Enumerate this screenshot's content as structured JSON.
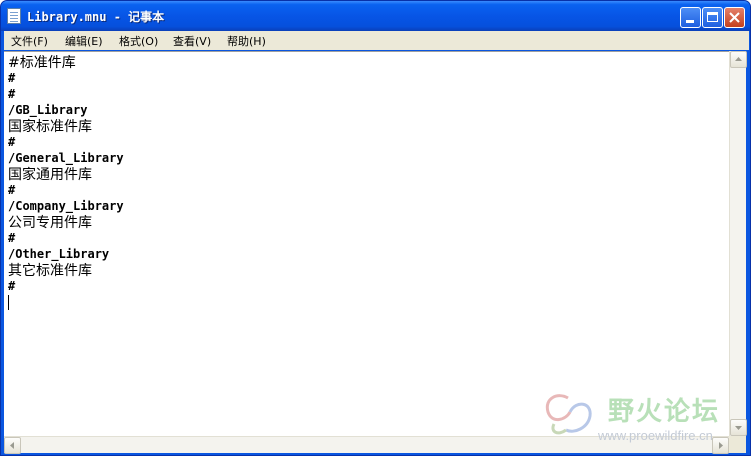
{
  "window": {
    "title": "Library.mnu - 记事本"
  },
  "menubar": {
    "items": [
      {
        "label": "文件(F)"
      },
      {
        "label": "编辑(E)"
      },
      {
        "label": "格式(O)"
      },
      {
        "label": "查看(V)"
      },
      {
        "label": "帮助(H)"
      }
    ]
  },
  "editor": {
    "lines": [
      {
        "text": "#标准件库",
        "style": "cjk"
      },
      {
        "text": "#",
        "style": "mono"
      },
      {
        "text": "#",
        "style": "mono"
      },
      {
        "text": "/GB_Library",
        "style": "mono"
      },
      {
        "text": "国家标准件库",
        "style": "cjk"
      },
      {
        "text": "#",
        "style": "mono"
      },
      {
        "text": "/General_Library",
        "style": "mono"
      },
      {
        "text": "国家通用件库",
        "style": "cjk"
      },
      {
        "text": "#",
        "style": "mono"
      },
      {
        "text": "/Company_Library",
        "style": "mono"
      },
      {
        "text": "公司专用件库",
        "style": "cjk"
      },
      {
        "text": "#",
        "style": "mono"
      },
      {
        "text": "/Other_Library",
        "style": "mono"
      },
      {
        "text": "其它标准件库",
        "style": "cjk"
      },
      {
        "text": "#",
        "style": "mono"
      }
    ]
  },
  "watermark": {
    "title": "野火论坛",
    "url": "www.proewildfire.cn"
  },
  "colors": {
    "titlebar": "#0755e6",
    "menubar": "#ece9d8",
    "watermark_green": "#b8e0b8"
  }
}
